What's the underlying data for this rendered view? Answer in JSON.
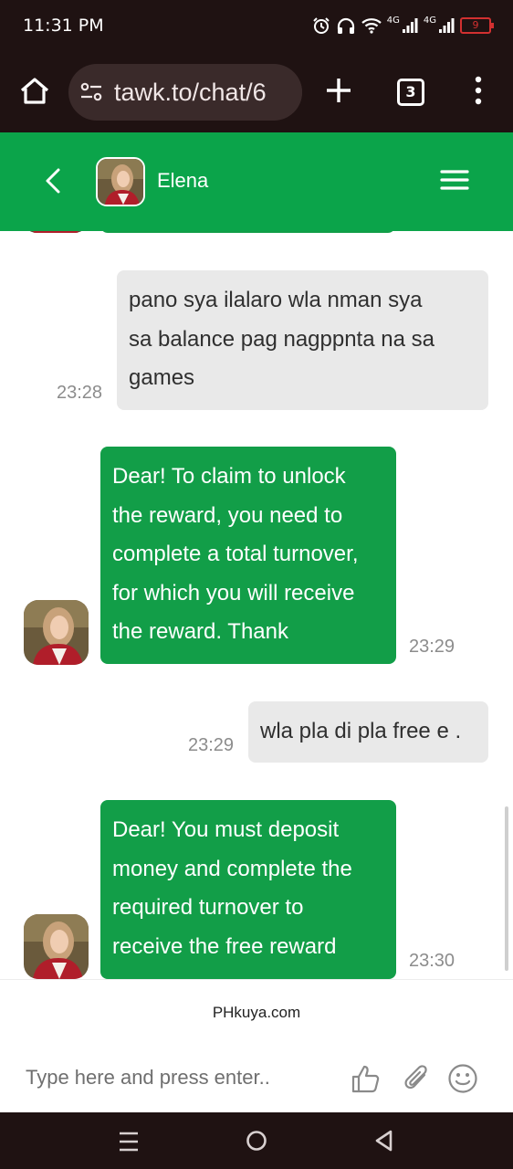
{
  "status_bar": {
    "time": "11:31 PM",
    "network_1": "4G",
    "network_2": "4G",
    "battery": "9",
    "icons": [
      "alarm-icon",
      "headphones-icon",
      "wifi-icon",
      "signal-icon",
      "signal-icon",
      "battery-icon"
    ]
  },
  "browser": {
    "url": "tawk.to/chat/6",
    "tab_count": "3",
    "icons": [
      "home-icon",
      "tune-icon",
      "plus-icon",
      "tabs-icon",
      "more-vert-icon"
    ]
  },
  "chat_header": {
    "agent_name": "Elena",
    "icons": [
      "back-chevron-icon",
      "hamburger-icon"
    ]
  },
  "messages": [
    {
      "sender": "user",
      "lines": [
        "pano sya ilalaro wla nman sya",
        "sa balance pag nagppnta na sa",
        "games"
      ],
      "time": "23:28"
    },
    {
      "sender": "agent",
      "lines": [
        "Dear! To claim to unlock",
        "the reward, you need to",
        "complete a total turnover,",
        "for which you will receive",
        "the reward. Thank"
      ],
      "time": "23:29"
    },
    {
      "sender": "user",
      "lines": [
        "wla pla di pla free e ."
      ],
      "time": "23:29"
    },
    {
      "sender": "agent",
      "lines": [
        "Dear! You must deposit",
        "money and complete the",
        "required turnover to",
        "receive the free reward"
      ],
      "time": "23:30"
    }
  ],
  "footer": {
    "brand": "PHkuya.com",
    "input_placeholder": "Type here and press enter..",
    "icons": [
      "thumbs-up-icon",
      "paperclip-icon",
      "emoji-icon"
    ]
  },
  "colors": {
    "accent_green": "#0ba44a",
    "agent_bubble": "#129e48",
    "user_bubble": "#e9e9e9",
    "system_bar": "#1f1212"
  }
}
